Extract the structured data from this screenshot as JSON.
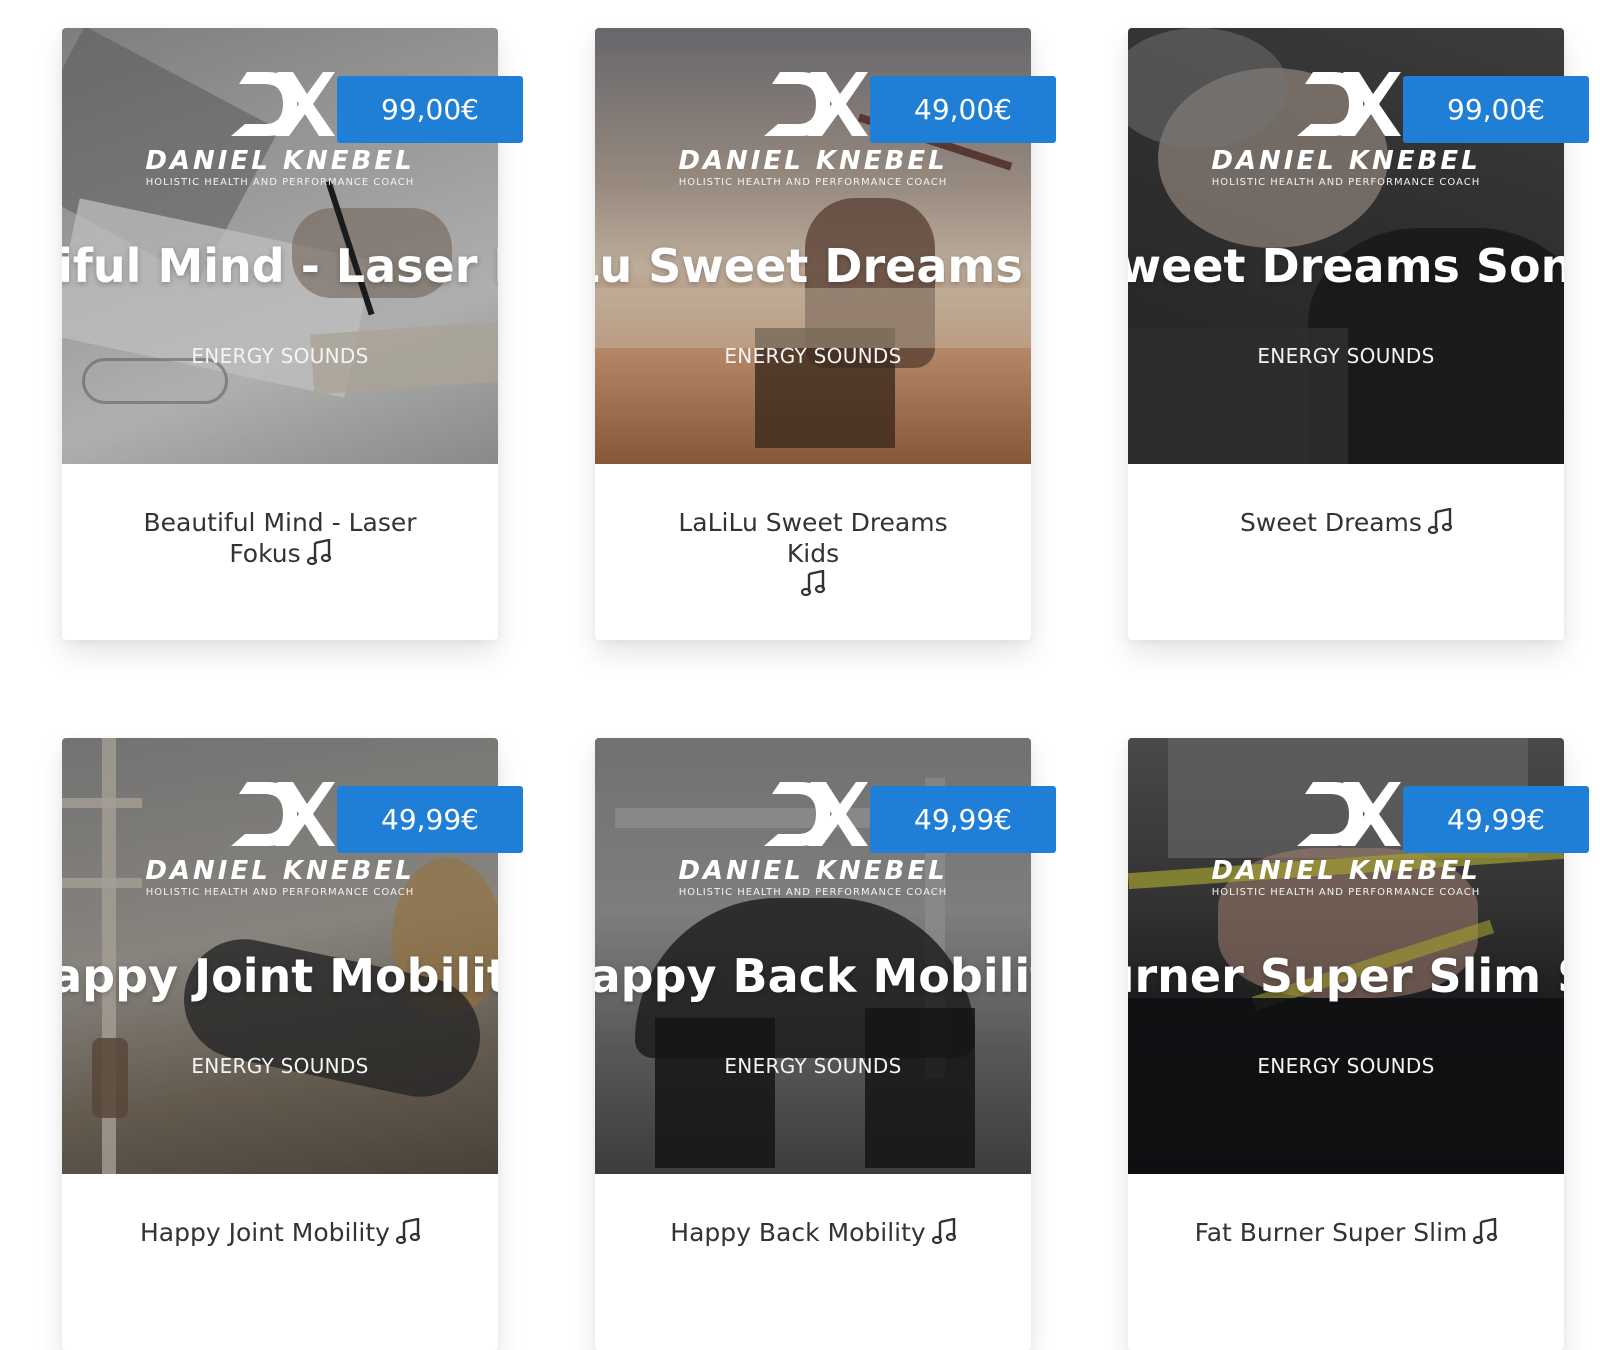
{
  "brand": {
    "name": "DANIEL KNEBEL",
    "tagline": "HOLISTIC HEALTH AND PERFORMANCE COACH"
  },
  "accent_color": "#1f7fd6",
  "products": [
    {
      "price": "99,00€",
      "cover_title": "tiful Mind - Laser F",
      "cover_label": "ENERGY SOUNDS",
      "title": "Beautiful Mind - Laser Fokus",
      "icon": "music-note-icon"
    },
    {
      "price": "49,00€",
      "cover_title": "Lu Sweet Dreams I",
      "cover_label": "ENERGY SOUNDS",
      "title": "LaLiLu Sweet Dreams Kids",
      "icon": "music-note-icon"
    },
    {
      "price": "99,00€",
      "cover_title": "weet Dreams Son",
      "cover_label": "ENERGY SOUNDS",
      "title": "Sweet Dreams",
      "icon": "music-note-icon"
    },
    {
      "price": "49,99€",
      "cover_title": "appy Joint Mobilit",
      "cover_label": "ENERGY SOUNDS",
      "title": "Happy Joint Mobility",
      "icon": "music-note-icon"
    },
    {
      "price": "49,99€",
      "cover_title": "lappy Back Mobilit",
      "cover_label": "ENERGY SOUNDS",
      "title": "Happy Back Mobility",
      "icon": "music-note-icon"
    },
    {
      "price": "49,99€",
      "cover_title": "urner Super Slim S",
      "cover_label": "ENERGY SOUNDS",
      "title": "Fat Burner Super Slim",
      "icon": "music-note-icon"
    }
  ]
}
